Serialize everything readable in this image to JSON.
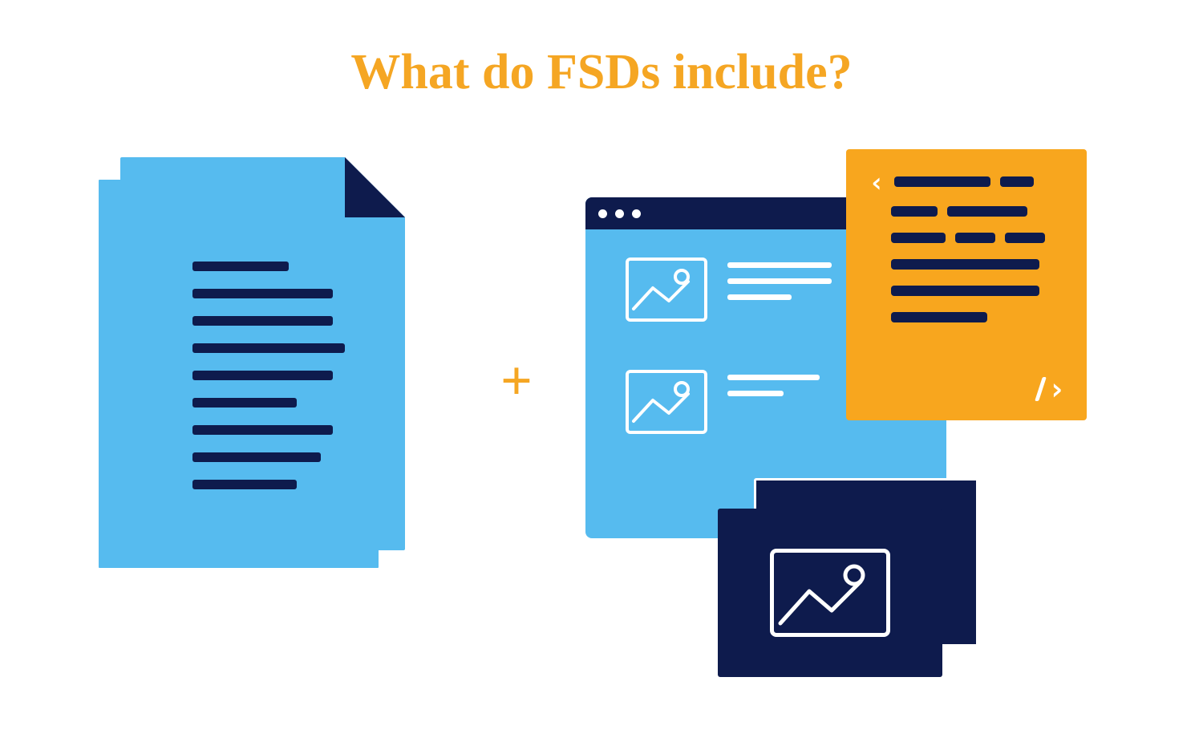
{
  "title": "What do FSDs include?",
  "colors": {
    "accent": "#f5a623",
    "blue": "#56bbef",
    "navy": "#0e1b4d",
    "white": "#ffffff",
    "orange": "#f8a61e"
  },
  "plus_symbol": "+",
  "illustrations": {
    "left": "text-document-stack",
    "right": "browser-wireframe-code-images"
  }
}
